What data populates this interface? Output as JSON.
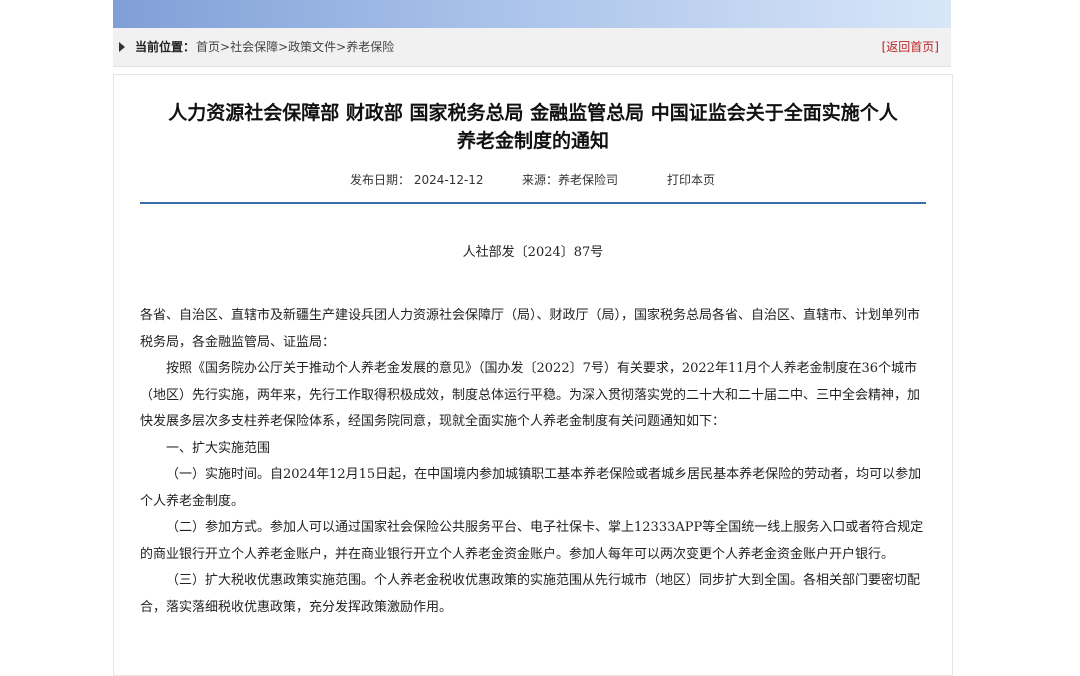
{
  "breadcrumb": {
    "label": "当前位置：",
    "items": [
      "首页",
      "社会保障",
      "政策文件",
      "养老保险"
    ],
    "separator": ">",
    "back_home": "[返回首页]"
  },
  "article": {
    "title_line1": "人力资源社会保障部 财政部 国家税务总局 金融监管总局 中国证监会关于全面实施个人",
    "title_line2": "养老金制度的通知",
    "publish_date": "发布日期：  2024-12-12",
    "source": "来源：养老保险司",
    "print": "打印本页",
    "doc_number": "人社部发〔2024〕87号",
    "paragraphs": [
      "各省、自治区、直辖市及新疆生产建设兵团人力资源社会保障厅（局）、财政厅（局），国家税务总局各省、自治区、直辖市、计划单列市税务局，各金融监管局、证监局：",
      "按照《国务院办公厅关于推动个人养老金发展的意见》（国办发〔2022〕7号）有关要求，2022年11月个人养老金制度在36个城市（地区）先行实施，两年来，先行工作取得积极成效，制度总体运行平稳。为深入贯彻落实党的二十大和二十届二中、三中全会精神，加快发展多层次多支柱养老保险体系，经国务院同意，现就全面实施个人养老金制度有关问题通知如下：",
      "一、扩大实施范围",
      "（一）实施时间。自2024年12月15日起，在中国境内参加城镇职工基本养老保险或者城乡居民基本养老保险的劳动者，均可以参加个人养老金制度。",
      "（二）参加方式。参加人可以通过国家社会保险公共服务平台、电子社保卡、掌上12333APP等全国统一线上服务入口或者符合规定的商业银行开立个人养老金账户，并在商业银行开立个人养老金资金账户。参加人每年可以两次变更个人养老金资金账户开户银行。",
      "（三）扩大税收优惠政策实施范围。个人养老金税收优惠政策的实施范围从先行城市（地区）同步扩大到全国。各相关部门要密切配合，落实落细税收优惠政策，充分发挥政策激励作用。"
    ]
  },
  "colors": {
    "banner": "#8fb0e0",
    "rule": "#3b6ea8",
    "back_home": "#bb2222"
  }
}
